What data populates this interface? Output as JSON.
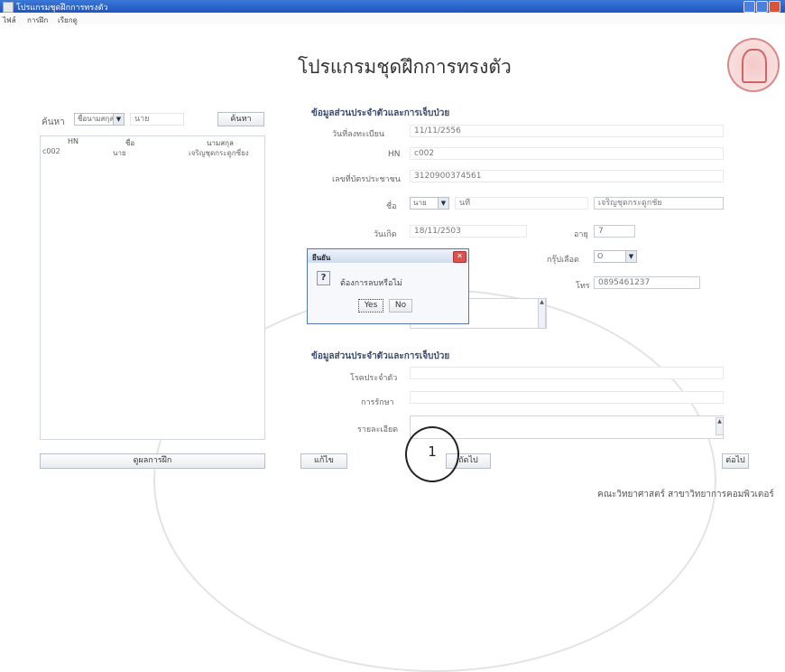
{
  "window": {
    "title": "โปรแกรมชุดฝึกการทรงตัว"
  },
  "menu": [
    "ไฟล์",
    "การฝึก",
    "เรียกดู"
  ],
  "main_title": "โปรแกรมชุดฝึกการทรงตัว",
  "search": {
    "label": "ค้นหา",
    "type_value": "ชื่อนามสกุล",
    "prefix": "นาย",
    "button": "ค้นหา",
    "columns": [
      "HN",
      "ชื่อ",
      "นามสกุล"
    ],
    "rows": [
      {
        "hn": "c002",
        "first": "นาย",
        "last": "เจริญชุดกระดูกซี่ยง"
      }
    ]
  },
  "section1": {
    "heading": "ข้อมูลส่วนประจำตัวและการเจ็บป่วย",
    "reg_date_label": "วันที่ลงทะเบียน",
    "reg_date": "11/11/2556",
    "hn_label": "HN",
    "hn": "c002",
    "id_label": "เลขที่บัตรประชาชน",
    "id": "3120900374561",
    "name_label": "ชื่อ",
    "prefix": "นาย",
    "first_name": "นที",
    "last_name": "เจริญชุดกระดูกชัย",
    "birth_label": "วันเกิด",
    "birth": "18/11/2503",
    "age_label": "อายุ",
    "age": "7",
    "blood_label": "กรุ๊ปเลือด",
    "blood": "O",
    "phone_label": "โทร",
    "phone": "0895461237"
  },
  "section2": {
    "heading": "ข้อมูลส่วนประจำตัวและการเจ็บป่วย",
    "disease_label": "โรคประจำตัว",
    "treat_label": "การรักษา",
    "notes_label": "รายละเอียด"
  },
  "dialog": {
    "title": "ยืนยัน",
    "message": "ต้องการลบหรือไม่",
    "yes": "Yes",
    "no": "No"
  },
  "bottom": {
    "summary_button": "ดูผลการฝึก",
    "edit_button": "แก้ไข",
    "next_button": "ถัดไป",
    "start_button": "ต่อไป",
    "page_marker": "1"
  },
  "footer": "คณะวิทยาศาสตร์ สาขาวิทยาการคอมพิวเตอร์"
}
